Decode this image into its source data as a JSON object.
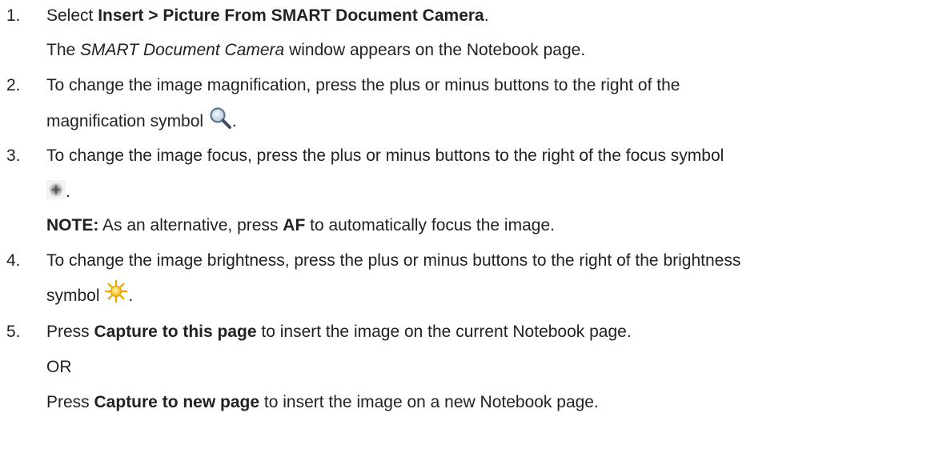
{
  "steps": [
    {
      "number": "1.",
      "pre": "Select ",
      "bold": "Insert > Picture From SMART Document Camera",
      "post": ".",
      "result_italic": "SMART Document Camera",
      "result_rest": " window appears on the Notebook page.",
      "result_pre": "The "
    },
    {
      "number": "2.",
      "line1": "To change the image magnification, press the plus or minus buttons to the right of the",
      "line2": "magnification symbol ",
      "end": ".",
      "icon": "magnifier-icon"
    },
    {
      "number": "3.",
      "line1": "To change the image focus, press the plus or minus buttons to the right of the focus symbol",
      "end": ".",
      "icon": "focus-icon",
      "note_label": "NOTE:",
      "note_pre": " As an alternative, press ",
      "note_bold": "AF",
      "note_post": " to automatically focus the image."
    },
    {
      "number": "4.",
      "line1": "To change the image brightness, press the plus or minus buttons to the right of the brightness",
      "line2": "symbol ",
      "end": ".",
      "icon": "brightness-icon"
    },
    {
      "number": "5.",
      "pre": "Press ",
      "bold": "Capture to this page",
      "post": " to insert the image on the current Notebook page.",
      "or": "OR",
      "alt_pre": "Press ",
      "alt_bold": "Capture to new page",
      "alt_post": " to insert the image on a new Notebook page."
    }
  ]
}
